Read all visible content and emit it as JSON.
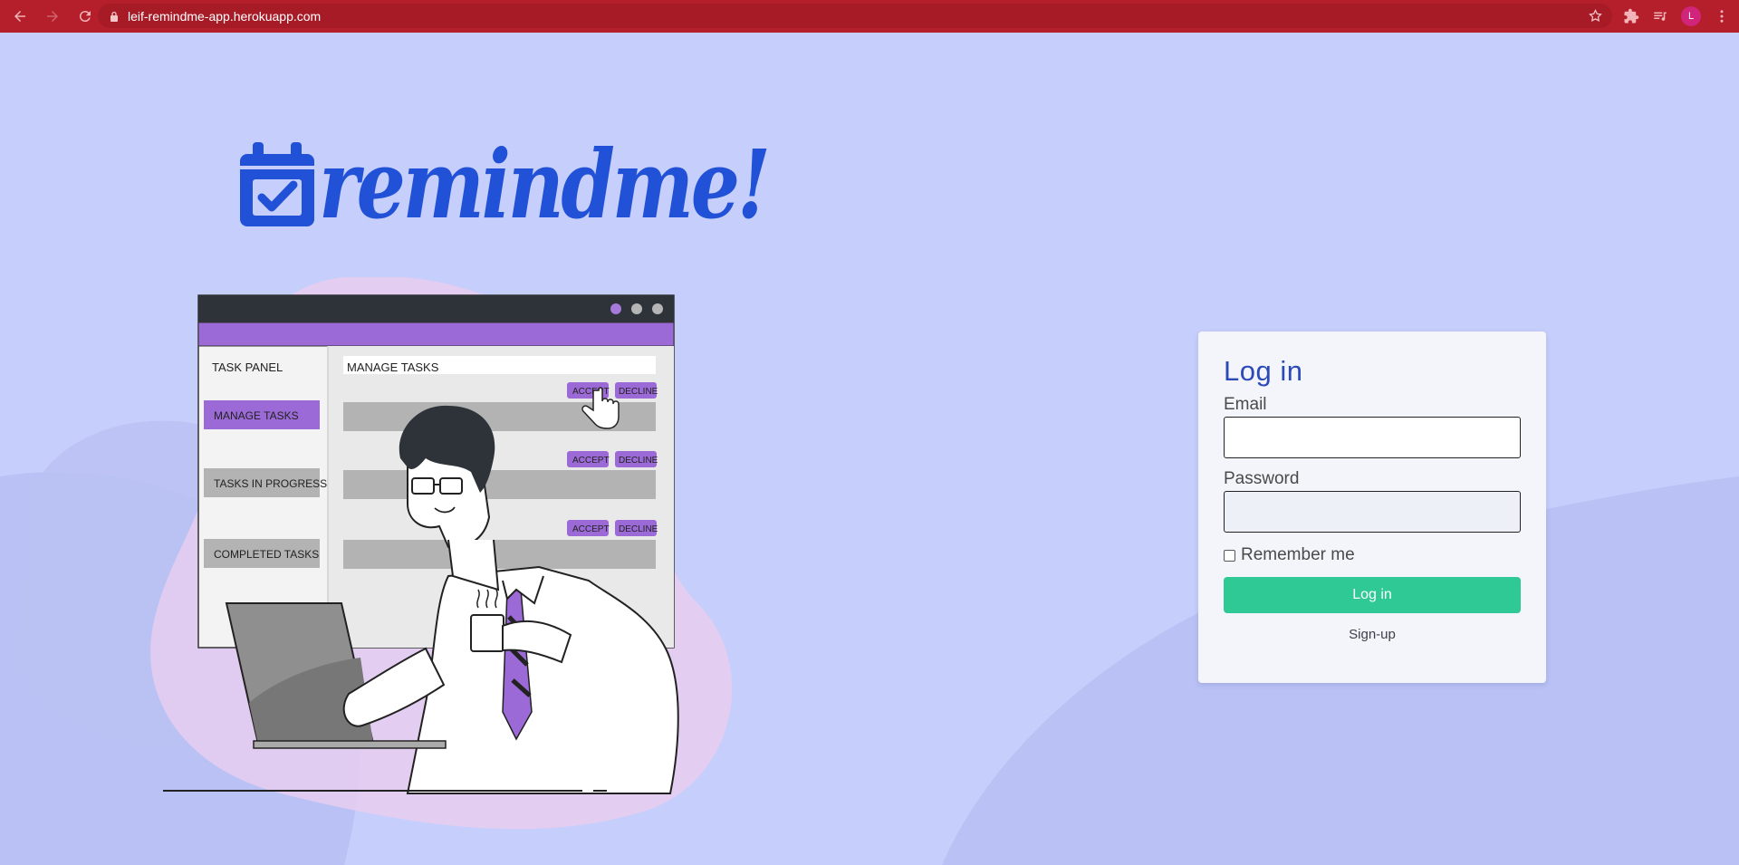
{
  "browser": {
    "url": "leif-remindme-app.herokuapp.com",
    "profile_initial": "L",
    "accent": "#b51f2c"
  },
  "logo": {
    "text": "remindme!",
    "icon": "calendar-check-icon",
    "color": "#2151d6"
  },
  "illustration": {
    "panel_title": "TASK PANEL",
    "sidebar_items": [
      "MANAGE TASKS",
      "TASKS IN PROGRESS",
      "COMPLETED TASKS"
    ],
    "header": "MANAGE TASKS",
    "accept_label": "ACCEPT",
    "decline_label": "DECLINE"
  },
  "login": {
    "title": "Log in",
    "email_label": "Email",
    "email_value": "",
    "password_label": "Password",
    "password_value": "",
    "remember_label": "Remember me",
    "remember_checked": false,
    "submit_label": "Log in",
    "signup_label": "Sign-up",
    "button_color": "#2fc995"
  }
}
